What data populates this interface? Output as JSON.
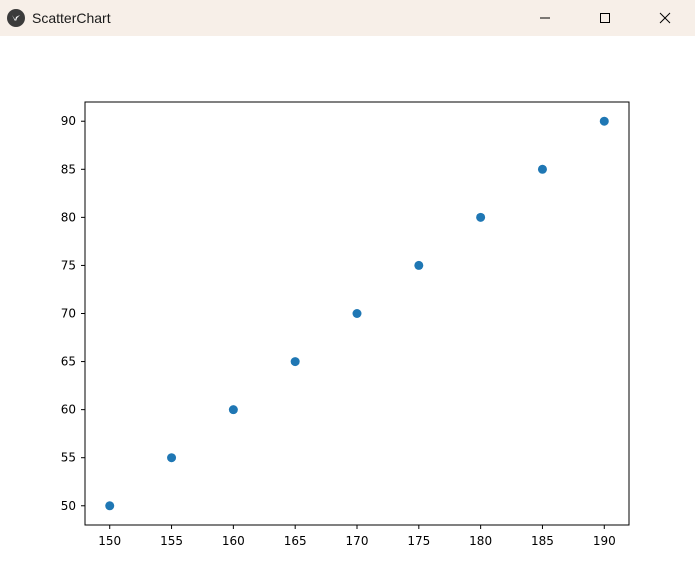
{
  "window": {
    "title": "ScatterChart",
    "app_icon": "kivy-logo-icon",
    "controls": [
      "minimize-icon",
      "maximize-icon",
      "close-icon"
    ]
  },
  "chart_data": {
    "type": "scatter",
    "title": "",
    "xlabel": "",
    "ylabel": "",
    "x": [
      150,
      155,
      160,
      165,
      170,
      175,
      180,
      185,
      190
    ],
    "y": [
      50,
      55,
      60,
      65,
      70,
      75,
      80,
      85,
      90
    ],
    "xlim": [
      148,
      192
    ],
    "ylim": [
      48,
      92
    ],
    "xticks": [
      150,
      155,
      160,
      165,
      170,
      175,
      180,
      185,
      190
    ],
    "yticks": [
      50,
      55,
      60,
      65,
      70,
      75,
      80,
      85,
      90
    ],
    "grid": false,
    "marker_color": "#1f77b4"
  }
}
